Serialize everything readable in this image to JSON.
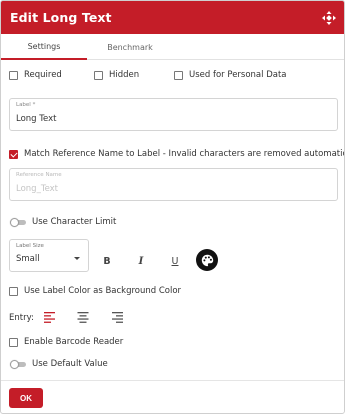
{
  "dialog": {
    "title": "Edit Long Text",
    "accent_color": "#c41d28",
    "drag_icon": "move-arrows-icon"
  },
  "tabs": [
    {
      "label": "Settings",
      "active": true
    },
    {
      "label": "Benchmark",
      "active": false
    }
  ],
  "options": {
    "required": {
      "label": "Required",
      "checked": false
    },
    "hidden": {
      "label": "Hidden",
      "checked": false
    },
    "personal_data": {
      "label": "Used for Personal Data",
      "checked": false
    }
  },
  "label_field": {
    "label": "Label *",
    "value": "Long Text"
  },
  "match_reference": {
    "label": "Match Reference Name to Label - Invalid characters are removed automatically.",
    "checked": true
  },
  "reference_field": {
    "label": "Reference Name",
    "value": "Long_Text",
    "disabled": true
  },
  "character_limit": {
    "label": "Use Character Limit",
    "on": false
  },
  "label_size": {
    "label": "Label Size",
    "value": "Small"
  },
  "formatting": {
    "bold": "B",
    "italic": "I",
    "underline": "U",
    "palette_icon": "palette-icon"
  },
  "label_color_bg": {
    "label": "Use Label Color as Background Color",
    "checked": false
  },
  "entry": {
    "label": "Entry:",
    "alignments": [
      {
        "name": "align-left-icon",
        "active": true
      },
      {
        "name": "align-center-icon",
        "active": false
      },
      {
        "name": "align-right-icon",
        "active": false
      }
    ]
  },
  "barcode_reader": {
    "label": "Enable Barcode Reader",
    "checked": false
  },
  "default_value": {
    "label": "Use Default Value",
    "on": false
  },
  "footer": {
    "ok_label": "OK"
  }
}
